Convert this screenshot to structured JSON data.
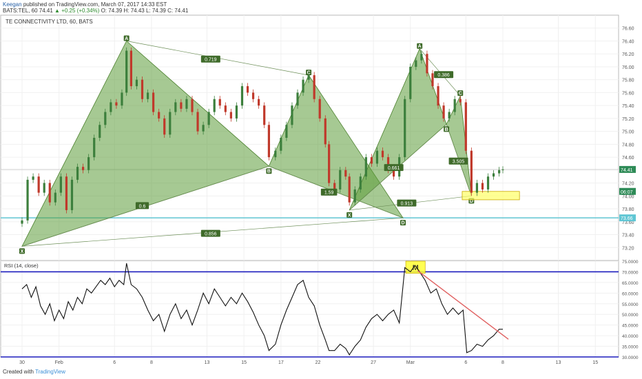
{
  "header": {
    "author": "Keegan",
    "published": "published on TradingView.com, March 07, 2017 14:33 EST",
    "symbol_line": "BATS:TEL, 60",
    "last": "74.41",
    "change": "▲ +0.25 (+0.34%)",
    "ohlc": "O: 74.39 H: 74.43 L: 74.39 C: 74.41"
  },
  "footer": {
    "created_with": "Created with",
    "brand": "TradingView"
  },
  "chart_data": [
    {
      "type": "candlestick",
      "title": "TE CONNECTIVITY LTD, 60, BATS",
      "ylim": [
        73.0,
        76.8
      ],
      "y_ticks": [
        "76.60",
        "76.40",
        "76.20",
        "76.00",
        "75.80",
        "75.60",
        "75.40",
        "75.20",
        "75.00",
        "74.80",
        "74.60",
        "74.40",
        "74.20",
        "74.00",
        "73.80",
        "73.60",
        "73.40",
        "73.20"
      ],
      "x_ticks": [
        {
          "label": "30",
          "pos": 0.0
        },
        {
          "label": "Feb",
          "pos": 2.0
        },
        {
          "label": "6",
          "pos": 5.0
        },
        {
          "label": "8",
          "pos": 7.0
        },
        {
          "label": "13",
          "pos": 10.0
        },
        {
          "label": "15",
          "pos": 12.0
        },
        {
          "label": "17",
          "pos": 14.0
        },
        {
          "label": "22",
          "pos": 16.0
        },
        {
          "label": "27",
          "pos": 19.0
        },
        {
          "label": "Mar",
          "pos": 21.0
        },
        {
          "label": "6",
          "pos": 24.0
        },
        {
          "label": "8",
          "pos": 26.0
        },
        {
          "label": "13",
          "pos": 29.0
        },
        {
          "label": "15",
          "pos": 31.0
        }
      ],
      "price_labels": [
        {
          "value": 74.41,
          "text": "74.41",
          "color": "#2e8b57"
        },
        {
          "value": 74.07,
          "text": "06:07",
          "color": "#2e8b57"
        },
        {
          "value": 73.66,
          "text": "73.66",
          "color": "#5fc6d4"
        }
      ],
      "horizontal_lines": [
        {
          "value": 73.66,
          "color": "#6cc9d6"
        },
        {
          "value": 74.41,
          "color": "#bbbbbb"
        }
      ],
      "patterns": [
        {
          "points": [
            {
              "label": "X",
              "x": 0.0,
              "y": 73.22
            },
            {
              "label": "A",
              "x": 5.65,
              "y": 76.4
            },
            {
              "label": "B",
              "x": 13.35,
              "y": 74.46
            },
            {
              "label": "C",
              "x": 15.5,
              "y": 75.87
            },
            {
              "label": "D",
              "x": 20.6,
              "y": 73.66
            }
          ],
          "ratios": [
            {
              "text": "0.6",
              "x": 6.5,
              "y": 73.85
            },
            {
              "text": "0.719",
              "x": 10.2,
              "y": 76.12
            },
            {
              "text": "1.59",
              "x": 16.6,
              "y": 74.06
            },
            {
              "text": "0.856",
              "x": 10.2,
              "y": 73.42
            }
          ]
        },
        {
          "points": [
            {
              "label": "X",
              "x": 17.7,
              "y": 73.78
            },
            {
              "label": "A",
              "x": 21.5,
              "y": 76.28
            },
            {
              "label": "B",
              "x": 22.95,
              "y": 75.11
            },
            {
              "label": "C",
              "x": 23.7,
              "y": 75.55
            },
            {
              "label": "D",
              "x": 24.3,
              "y": 74.0
            }
          ],
          "ratios": [
            {
              "text": "0.386",
              "x": 22.8,
              "y": 75.88
            },
            {
              "text": "0.913",
              "x": 20.8,
              "y": 73.89
            },
            {
              "text": "0.661",
              "x": 20.1,
              "y": 74.44
            },
            {
              "text": "3.505",
              "x": 23.6,
              "y": 74.54
            }
          ]
        }
      ],
      "highlight_box": {
        "x0": 23.8,
        "x1": 26.9,
        "y0": 73.94,
        "y1": 74.07,
        "color": "#ffff66"
      },
      "close": [
        {
          "x": 0.0,
          "y": 73.62
        },
        {
          "x": 0.3,
          "y": 74.25
        },
        {
          "x": 0.6,
          "y": 74.3
        },
        {
          "x": 0.9,
          "y": 74.05
        },
        {
          "x": 1.2,
          "y": 74.2
        },
        {
          "x": 1.5,
          "y": 73.9
        },
        {
          "x": 1.8,
          "y": 74.05
        },
        {
          "x": 2.1,
          "y": 74.3
        },
        {
          "x": 2.4,
          "y": 73.78
        },
        {
          "x": 2.7,
          "y": 74.25
        },
        {
          "x": 3.0,
          "y": 74.45
        },
        {
          "x": 3.3,
          "y": 74.4
        },
        {
          "x": 3.6,
          "y": 74.6
        },
        {
          "x": 3.9,
          "y": 74.9
        },
        {
          "x": 4.2,
          "y": 75.1
        },
        {
          "x": 4.5,
          "y": 75.3
        },
        {
          "x": 4.8,
          "y": 75.45
        },
        {
          "x": 5.1,
          "y": 75.4
        },
        {
          "x": 5.4,
          "y": 75.6
        },
        {
          "x": 5.65,
          "y": 76.25
        },
        {
          "x": 5.9,
          "y": 75.7
        },
        {
          "x": 6.2,
          "y": 75.8
        },
        {
          "x": 6.5,
          "y": 75.5
        },
        {
          "x": 6.8,
          "y": 75.6
        },
        {
          "x": 7.1,
          "y": 75.3
        },
        {
          "x": 7.4,
          "y": 75.2
        },
        {
          "x": 7.7,
          "y": 74.95
        },
        {
          "x": 8.0,
          "y": 75.3
        },
        {
          "x": 8.3,
          "y": 75.45
        },
        {
          "x": 8.6,
          "y": 75.35
        },
        {
          "x": 8.9,
          "y": 75.5
        },
        {
          "x": 9.2,
          "y": 75.3
        },
        {
          "x": 9.5,
          "y": 75.0
        },
        {
          "x": 9.8,
          "y": 75.1
        },
        {
          "x": 10.1,
          "y": 75.3
        },
        {
          "x": 10.4,
          "y": 75.5
        },
        {
          "x": 10.7,
          "y": 75.4
        },
        {
          "x": 11.0,
          "y": 75.3
        },
        {
          "x": 11.3,
          "y": 75.2
        },
        {
          "x": 11.6,
          "y": 75.4
        },
        {
          "x": 11.9,
          "y": 75.7
        },
        {
          "x": 12.2,
          "y": 75.6
        },
        {
          "x": 12.5,
          "y": 75.5
        },
        {
          "x": 12.8,
          "y": 75.4
        },
        {
          "x": 13.1,
          "y": 75.1
        },
        {
          "x": 13.35,
          "y": 74.6
        },
        {
          "x": 13.7,
          "y": 74.7
        },
        {
          "x": 14.0,
          "y": 74.9
        },
        {
          "x": 14.3,
          "y": 75.1
        },
        {
          "x": 14.6,
          "y": 75.4
        },
        {
          "x": 14.9,
          "y": 75.6
        },
        {
          "x": 15.2,
          "y": 75.8
        },
        {
          "x": 15.5,
          "y": 75.87
        },
        {
          "x": 15.8,
          "y": 75.5
        },
        {
          "x": 16.1,
          "y": 75.2
        },
        {
          "x": 16.4,
          "y": 74.8
        },
        {
          "x": 16.6,
          "y": 74.2
        },
        {
          "x": 16.9,
          "y": 74.1
        },
        {
          "x": 17.2,
          "y": 74.4
        },
        {
          "x": 17.5,
          "y": 74.3
        },
        {
          "x": 17.7,
          "y": 73.9
        },
        {
          "x": 18.0,
          "y": 74.1
        },
        {
          "x": 18.3,
          "y": 74.3
        },
        {
          "x": 18.6,
          "y": 74.6
        },
        {
          "x": 18.9,
          "y": 74.5
        },
        {
          "x": 19.2,
          "y": 74.7
        },
        {
          "x": 19.5,
          "y": 74.6
        },
        {
          "x": 19.8,
          "y": 74.4
        },
        {
          "x": 20.1,
          "y": 74.3
        },
        {
          "x": 20.4,
          "y": 74.6
        },
        {
          "x": 20.7,
          "y": 75.5
        },
        {
          "x": 21.0,
          "y": 76.0
        },
        {
          "x": 21.3,
          "y": 76.1
        },
        {
          "x": 21.6,
          "y": 76.2
        },
        {
          "x": 21.9,
          "y": 75.9
        },
        {
          "x": 22.2,
          "y": 75.7
        },
        {
          "x": 22.5,
          "y": 75.4
        },
        {
          "x": 22.8,
          "y": 75.2
        },
        {
          "x": 23.1,
          "y": 75.3
        },
        {
          "x": 23.4,
          "y": 75.5
        },
        {
          "x": 23.7,
          "y": 75.45
        },
        {
          "x": 24.0,
          "y": 74.7
        },
        {
          "x": 24.3,
          "y": 74.05
        },
        {
          "x": 24.6,
          "y": 74.2
        },
        {
          "x": 24.9,
          "y": 74.1
        },
        {
          "x": 25.2,
          "y": 74.3
        },
        {
          "x": 25.5,
          "y": 74.35
        },
        {
          "x": 25.8,
          "y": 74.4
        },
        {
          "x": 26.0,
          "y": 74.41
        }
      ]
    },
    {
      "type": "line",
      "title": "RSI (14, close)",
      "ylim": [
        30,
        75
      ],
      "y_ticks": [
        "75.0000",
        "70.0000",
        "65.0000",
        "60.0000",
        "55.0000",
        "50.0000",
        "45.0000",
        "40.0000",
        "35.0000",
        "30.0000"
      ],
      "hlines": [
        {
          "value": 70,
          "color": "#1b1bbd"
        },
        {
          "value": 30,
          "color": "#1b1bbd"
        }
      ],
      "trendline": {
        "x0": 21.4,
        "y0": 70.5,
        "x1": 26.3,
        "y1": 38.3,
        "color": "#e06060"
      },
      "highlight": {
        "x0": 20.75,
        "x1": 21.8,
        "y0": 69.3,
        "y1": 75.0,
        "label": "M",
        "color": "#ffff33"
      },
      "series": [
        {
          "values": [
            {
              "x": 0.0,
              "y": 62
            },
            {
              "x": 0.25,
              "y": 64
            },
            {
              "x": 0.5,
              "y": 58
            },
            {
              "x": 0.75,
              "y": 63
            },
            {
              "x": 1.0,
              "y": 54
            },
            {
              "x": 1.25,
              "y": 50
            },
            {
              "x": 1.5,
              "y": 55
            },
            {
              "x": 1.75,
              "y": 47
            },
            {
              "x": 2.0,
              "y": 52
            },
            {
              "x": 2.25,
              "y": 48
            },
            {
              "x": 2.5,
              "y": 56
            },
            {
              "x": 2.75,
              "y": 52
            },
            {
              "x": 3.0,
              "y": 58
            },
            {
              "x": 3.25,
              "y": 55
            },
            {
              "x": 3.5,
              "y": 62
            },
            {
              "x": 3.75,
              "y": 60
            },
            {
              "x": 4.0,
              "y": 63
            },
            {
              "x": 4.25,
              "y": 66
            },
            {
              "x": 4.5,
              "y": 64
            },
            {
              "x": 4.75,
              "y": 67
            },
            {
              "x": 5.0,
              "y": 63
            },
            {
              "x": 5.25,
              "y": 66
            },
            {
              "x": 5.5,
              "y": 64
            },
            {
              "x": 5.65,
              "y": 74
            },
            {
              "x": 5.9,
              "y": 64
            },
            {
              "x": 6.2,
              "y": 62
            },
            {
              "x": 6.5,
              "y": 58
            },
            {
              "x": 6.8,
              "y": 52
            },
            {
              "x": 7.1,
              "y": 47
            },
            {
              "x": 7.4,
              "y": 50
            },
            {
              "x": 7.7,
              "y": 42
            },
            {
              "x": 8.0,
              "y": 50
            },
            {
              "x": 8.3,
              "y": 55
            },
            {
              "x": 8.6,
              "y": 48
            },
            {
              "x": 8.9,
              "y": 52
            },
            {
              "x": 9.2,
              "y": 45
            },
            {
              "x": 9.5,
              "y": 52
            },
            {
              "x": 9.8,
              "y": 60
            },
            {
              "x": 10.1,
              "y": 55
            },
            {
              "x": 10.4,
              "y": 62
            },
            {
              "x": 10.7,
              "y": 58
            },
            {
              "x": 11.0,
              "y": 54
            },
            {
              "x": 11.3,
              "y": 58
            },
            {
              "x": 11.6,
              "y": 55
            },
            {
              "x": 11.9,
              "y": 60
            },
            {
              "x": 12.2,
              "y": 56
            },
            {
              "x": 12.5,
              "y": 51
            },
            {
              "x": 12.8,
              "y": 45
            },
            {
              "x": 13.1,
              "y": 40
            },
            {
              "x": 13.35,
              "y": 33
            },
            {
              "x": 13.7,
              "y": 36
            },
            {
              "x": 14.0,
              "y": 45
            },
            {
              "x": 14.3,
              "y": 52
            },
            {
              "x": 14.6,
              "y": 58
            },
            {
              "x": 14.9,
              "y": 64
            },
            {
              "x": 15.2,
              "y": 66
            },
            {
              "x": 15.5,
              "y": 58
            },
            {
              "x": 15.8,
              "y": 54
            },
            {
              "x": 16.1,
              "y": 45
            },
            {
              "x": 16.4,
              "y": 38
            },
            {
              "x": 16.6,
              "y": 33
            },
            {
              "x": 16.9,
              "y": 33
            },
            {
              "x": 17.2,
              "y": 36
            },
            {
              "x": 17.5,
              "y": 34
            },
            {
              "x": 17.7,
              "y": 31
            },
            {
              "x": 18.0,
              "y": 35
            },
            {
              "x": 18.3,
              "y": 38
            },
            {
              "x": 18.6,
              "y": 44
            },
            {
              "x": 18.9,
              "y": 48
            },
            {
              "x": 19.2,
              "y": 50
            },
            {
              "x": 19.5,
              "y": 47
            },
            {
              "x": 19.8,
              "y": 50
            },
            {
              "x": 20.1,
              "y": 52
            },
            {
              "x": 20.4,
              "y": 46
            },
            {
              "x": 20.7,
              "y": 72
            },
            {
              "x": 21.0,
              "y": 70
            },
            {
              "x": 21.25,
              "y": 73
            },
            {
              "x": 21.5,
              "y": 70
            },
            {
              "x": 21.8,
              "y": 66
            },
            {
              "x": 22.1,
              "y": 60
            },
            {
              "x": 22.4,
              "y": 62
            },
            {
              "x": 22.7,
              "y": 55
            },
            {
              "x": 23.0,
              "y": 50
            },
            {
              "x": 23.3,
              "y": 53
            },
            {
              "x": 23.6,
              "y": 50
            },
            {
              "x": 23.85,
              "y": 52
            },
            {
              "x": 24.05,
              "y": 32
            },
            {
              "x": 24.3,
              "y": 33
            },
            {
              "x": 24.6,
              "y": 36
            },
            {
              "x": 24.9,
              "y": 35
            },
            {
              "x": 25.2,
              "y": 38
            },
            {
              "x": 25.5,
              "y": 40
            },
            {
              "x": 25.8,
              "y": 43
            },
            {
              "x": 26.0,
              "y": 43
            }
          ]
        }
      ]
    }
  ]
}
